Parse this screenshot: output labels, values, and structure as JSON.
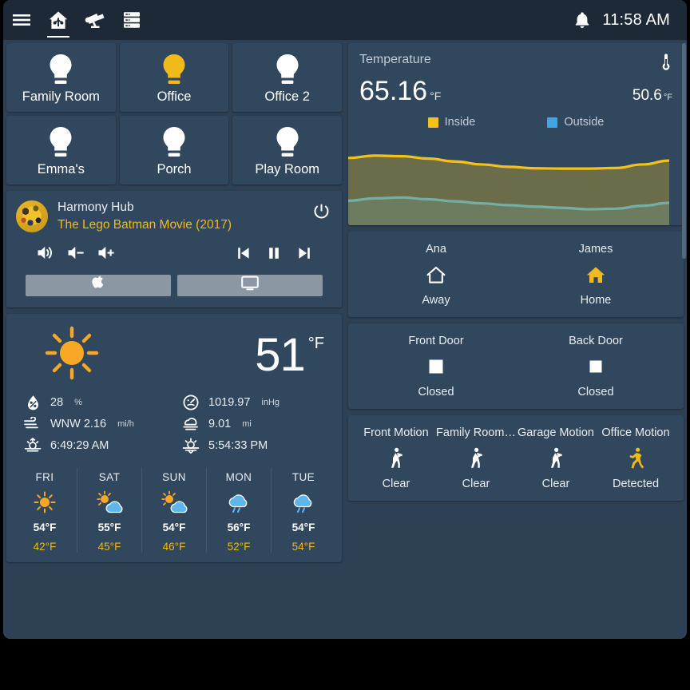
{
  "topbar": {
    "menu_icon": "hamburger-menu-icon",
    "tabs": [
      {
        "icon": "home-assistant-house-icon",
        "name": "home",
        "active": true
      },
      {
        "icon": "security-camera-icon",
        "name": "cameras",
        "active": false
      },
      {
        "icon": "server-rack-icon",
        "name": "system",
        "active": false
      }
    ],
    "bell_icon": "notification-bell-icon",
    "clock": "11:58 AM"
  },
  "lights": [
    {
      "name": "Family Room",
      "on": false
    },
    {
      "name": "Office",
      "on": true
    },
    {
      "name": "Office 2",
      "on": false
    },
    {
      "name": "Emma's",
      "on": false
    },
    {
      "name": "Porch",
      "on": false
    },
    {
      "name": "Play Room",
      "on": false
    }
  ],
  "media": {
    "title": "Harmony Hub",
    "now_playing": "The Lego Batman Movie (2017)",
    "power_icon": "power-icon",
    "controls": [
      {
        "icon": "volume-mute-icon",
        "name": "volume-mute"
      },
      {
        "icon": "volume-down-icon",
        "name": "volume-down"
      },
      {
        "icon": "volume-up-icon",
        "name": "volume-up"
      },
      {
        "icon": "previous-track-icon",
        "name": "previous-track"
      },
      {
        "icon": "pause-icon",
        "name": "pause"
      },
      {
        "icon": "next-track-icon",
        "name": "next-track"
      }
    ],
    "sources": [
      {
        "icon": "apple-logo-icon",
        "name": "apple-tv-source"
      },
      {
        "icon": "television-icon",
        "name": "tv-source"
      }
    ]
  },
  "weather": {
    "condition_icon": "sunny-icon",
    "temperature": "51",
    "unit": "°F",
    "details_left": [
      {
        "icon": "humidity-icon",
        "value": "28",
        "unit": "%"
      },
      {
        "icon": "wind-icon",
        "value": "WNW 2.16",
        "unit": "mi/h"
      },
      {
        "icon": "sunrise-icon",
        "value": "6:49:29 AM",
        "unit": ""
      }
    ],
    "details_right": [
      {
        "icon": "gauge-icon",
        "value": "1019.97",
        "unit": "inHg"
      },
      {
        "icon": "visibility-fog-icon",
        "value": "9.01",
        "unit": "mi"
      },
      {
        "icon": "sunset-icon",
        "value": "5:54:33 PM",
        "unit": ""
      }
    ],
    "forecast": [
      {
        "day": "FRI",
        "icon": "sunny-icon",
        "high": "54°F",
        "low": "42°F"
      },
      {
        "day": "SAT",
        "icon": "partly-cloudy-icon",
        "high": "55°F",
        "low": "45°F"
      },
      {
        "day": "SUN",
        "icon": "partly-cloudy-icon",
        "high": "54°F",
        "low": "46°F"
      },
      {
        "day": "MON",
        "icon": "rainy-icon",
        "high": "56°F",
        "low": "52°F"
      },
      {
        "day": "TUE",
        "icon": "rainy-icon",
        "high": "54°F",
        "low": "54°F"
      }
    ]
  },
  "temperature_card": {
    "label": "Temperature",
    "thermometer_icon": "thermometer-icon",
    "primary_value": "65.16",
    "primary_unit": "°F",
    "secondary_value": "50.6",
    "secondary_unit": "°F",
    "legend": [
      {
        "label": "Inside",
        "color": "#f2c21b"
      },
      {
        "label": "Outside",
        "color": "#3ea6e0"
      }
    ]
  },
  "chart_data": {
    "type": "area",
    "title": "Temperature",
    "xlabel": "",
    "ylabel": "°F",
    "ylim": [
      44,
      70
    ],
    "grid": false,
    "legend_position": "top-center",
    "x": [
      0,
      1,
      2,
      3,
      4,
      5,
      6,
      7,
      8,
      9,
      10,
      11,
      12
    ],
    "series": [
      {
        "name": "Inside",
        "color": "#f2c21b",
        "values": [
          66.8,
          67.6,
          67.4,
          66.6,
          65.6,
          64.6,
          63.8,
          63.3,
          63.2,
          63.2,
          63.4,
          64.6,
          65.9
        ]
      },
      {
        "name": "Outside",
        "color": "#3ea6e0",
        "values": [
          52.3,
          53.1,
          53.4,
          52.8,
          52.1,
          51.4,
          50.8,
          50.3,
          49.9,
          49.4,
          49.6,
          50.6,
          51.6
        ]
      }
    ]
  },
  "people": [
    {
      "name": "Ana",
      "state": "Away",
      "icon": "house-outline-icon",
      "active": false
    },
    {
      "name": "James",
      "state": "Home",
      "icon": "house-filled-icon",
      "active": true
    }
  ],
  "doors": [
    {
      "name": "Front Door",
      "state": "Closed",
      "icon": "square-closed-icon",
      "active": false
    },
    {
      "name": "Back Door",
      "state": "Closed",
      "icon": "square-closed-icon",
      "active": false
    }
  ],
  "motion": [
    {
      "name": "Front Motion",
      "state": "Clear",
      "icon": "walking-person-icon",
      "active": false
    },
    {
      "name": "Family Room…",
      "state": "Clear",
      "icon": "walking-person-icon",
      "active": false
    },
    {
      "name": "Garage Motion",
      "state": "Clear",
      "icon": "walking-person-icon",
      "active": false
    },
    {
      "name": "Office Motion",
      "state": "Detected",
      "icon": "running-person-icon",
      "active": true
    }
  ],
  "colors": {
    "background": "#2d4054",
    "card": "#31475e",
    "topbar": "#1d2936",
    "accent": "#f0b91c",
    "text": "#e9edf1",
    "inside_series": "#f2c21b",
    "outside_series": "#3ea6e0"
  }
}
